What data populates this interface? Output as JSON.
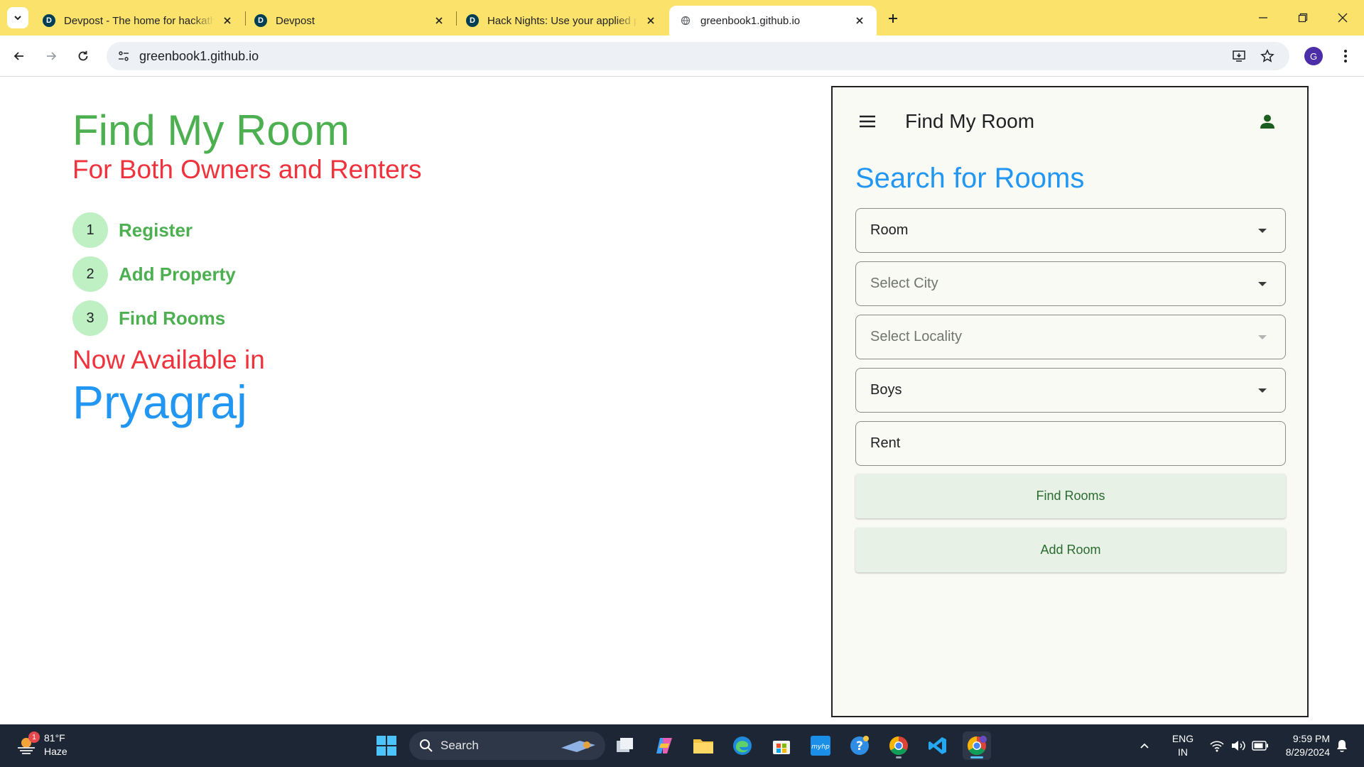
{
  "browser": {
    "tabs": [
      {
        "title": "Devpost - The home for hackathons",
        "favicon": "D"
      },
      {
        "title": "Devpost",
        "favicon": "D"
      },
      {
        "title": "Hack Nights: Use your applied projects",
        "favicon": "D"
      },
      {
        "title": "greenbook1.github.io",
        "favicon": "globe-icon"
      }
    ],
    "active_tab": 3,
    "url": "greenbook1.github.io",
    "profile_initial": "G"
  },
  "page": {
    "title": "Find My Room",
    "subtitle": "For Both Owners and Renters",
    "steps": [
      {
        "num": "1",
        "label": "Register"
      },
      {
        "num": "2",
        "label": "Add Property"
      },
      {
        "num": "3",
        "label": "Find Rooms"
      }
    ],
    "availability_text": "Now Available in",
    "city": "Pryagraj"
  },
  "app": {
    "title": "Find My Room",
    "search_heading": "Search for Rooms",
    "fields": {
      "room_type": "Room",
      "city_placeholder": "Select City",
      "locality_placeholder": "Select Locality",
      "gender": "Boys",
      "rent_placeholder": "Rent"
    },
    "find_button": "Find Rooms",
    "add_button": "Add Room"
  },
  "taskbar": {
    "weather_temp": "81°F",
    "weather_desc": "Haze",
    "weather_badge": "1",
    "search_label": "Search",
    "lang_line1": "ENG",
    "lang_line2": "IN",
    "time": "9:59 PM",
    "date": "8/29/2024"
  },
  "colors": {
    "tabstrip": "#fbe36b",
    "title_green": "#4caf50",
    "subtitle_red": "#f0323c",
    "city_blue": "#2196f3",
    "taskbar": "#1d2634"
  }
}
